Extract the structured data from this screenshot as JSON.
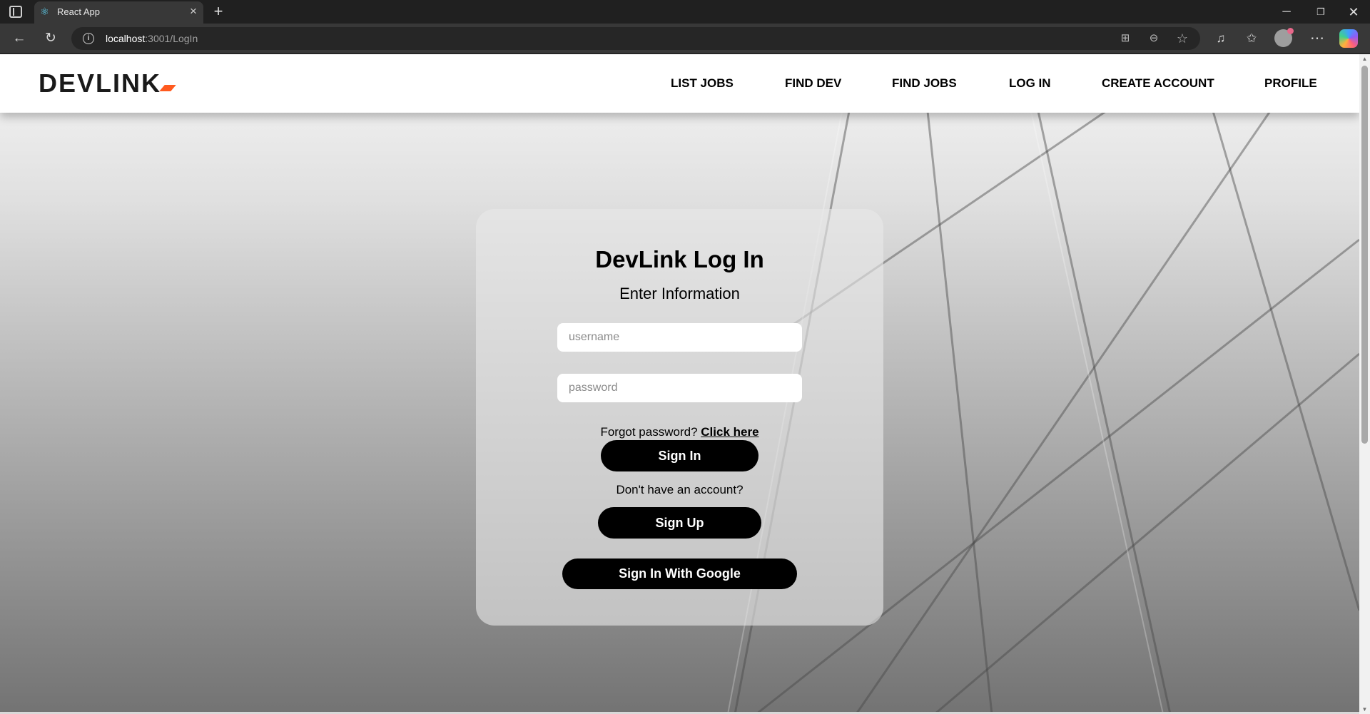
{
  "browser": {
    "tab_title": "React App",
    "url_host": "localhost",
    "url_rest": ":3001/LogIn"
  },
  "nav": {
    "logo": "DEVLINK",
    "links": [
      "LIST JOBS",
      "FIND DEV",
      "FIND JOBS",
      "LOG IN",
      "CREATE ACCOUNT",
      "PROFILE"
    ]
  },
  "login": {
    "title": "DevLink Log In",
    "subtitle": "Enter Information",
    "username_placeholder": "username",
    "password_placeholder": "password",
    "forgot_text": "Forgot password?",
    "forgot_link": "Click here",
    "signin_label": "Sign In",
    "no_account_text": "Don't have an account?",
    "signup_label": "Sign Up",
    "google_label": "Sign In With Google"
  },
  "colors": {
    "accent": "#ff5a1f",
    "button": "#000000"
  }
}
